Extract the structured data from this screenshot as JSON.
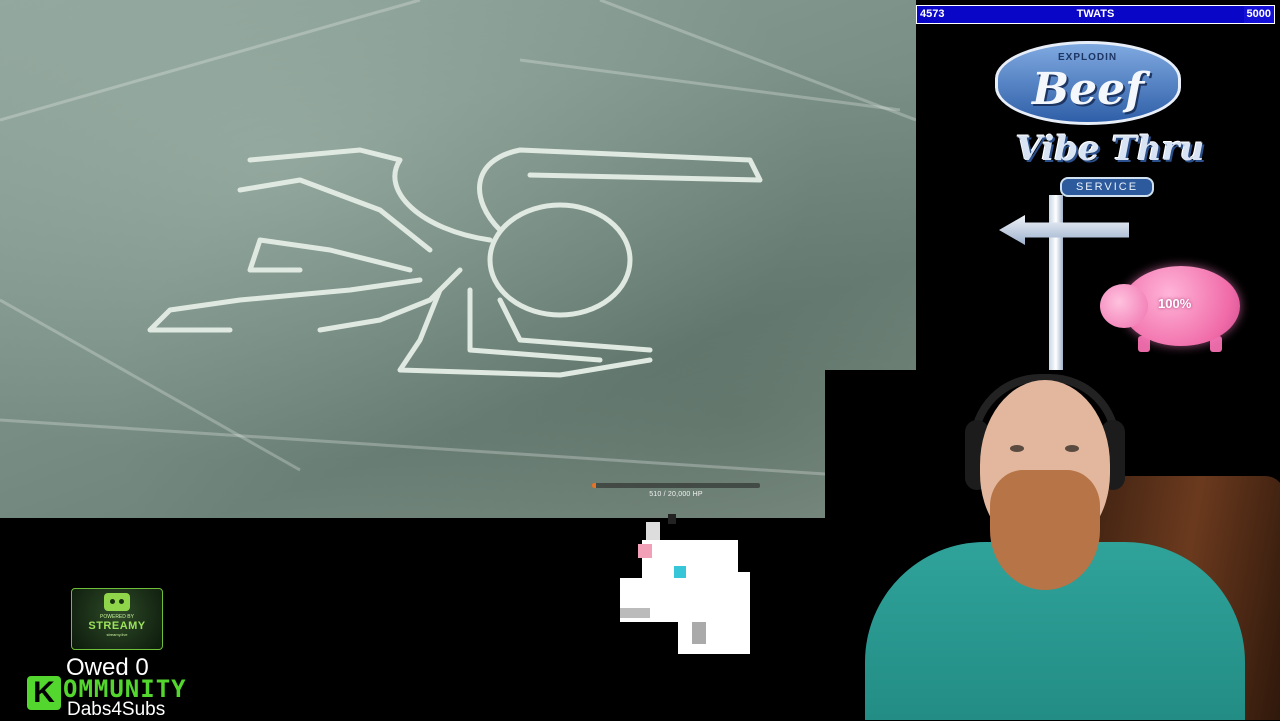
{
  "game": {
    "boss_hp_text": "510 / 20,000 HP",
    "boss_hp_fraction": 0.0255
  },
  "goal_bar": {
    "current": "4573",
    "label": "TWATS",
    "target": "5000",
    "fill_fraction": 0.9146,
    "color": "#1410d8"
  },
  "logo": {
    "line1": "Beef",
    "line1_small": "EXPLODIN",
    "line2": "Vibe Thru",
    "line3": "SERVICE"
  },
  "piggy_bank": {
    "percent": "100%",
    "color": "#f06aa8"
  },
  "streamy_badge": {
    "powered_by": "POWERED BY",
    "brand": "STREAMY",
    "url": "streamy.live"
  },
  "bottom_left": {
    "owed": "Owed 0",
    "kommunity_icon": "K",
    "kommunity": "OMMUNITY",
    "dabs": "Dabs4Subs",
    "accent": "#53d62e"
  }
}
